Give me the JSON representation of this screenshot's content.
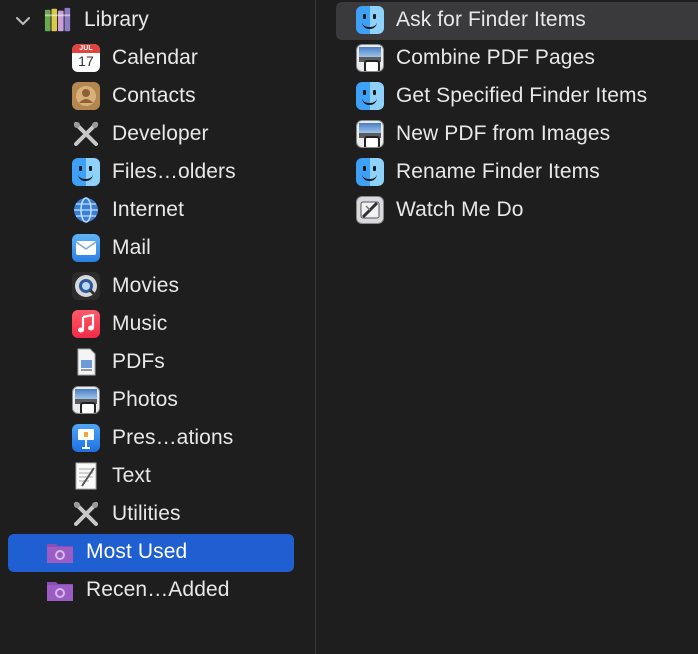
{
  "library": {
    "title": "Library",
    "categories": [
      {
        "label": "Calendar",
        "icon": "calendar-icon",
        "calendar_month": "JUL",
        "calendar_day": "17"
      },
      {
        "label": "Contacts",
        "icon": "contacts-icon"
      },
      {
        "label": "Developer",
        "icon": "developer-tools-icon"
      },
      {
        "label": "Files…olders",
        "icon": "finder-icon"
      },
      {
        "label": "Internet",
        "icon": "globe-icon"
      },
      {
        "label": "Mail",
        "icon": "mail-icon"
      },
      {
        "label": "Movies",
        "icon": "quicktime-icon"
      },
      {
        "label": "Music",
        "icon": "music-icon"
      },
      {
        "label": "PDFs",
        "icon": "pdf-document-icon"
      },
      {
        "label": "Photos",
        "icon": "preview-icon"
      },
      {
        "label": "Pres…ations",
        "icon": "keynote-icon"
      },
      {
        "label": "Text",
        "icon": "text-document-icon"
      },
      {
        "label": "Utilities",
        "icon": "utilities-tools-icon"
      }
    ],
    "smart_groups": [
      {
        "label": "Most Used",
        "icon": "smart-folder-icon",
        "selected": true
      },
      {
        "label": "Recen…Added",
        "icon": "smart-folder-icon",
        "selected": false
      }
    ]
  },
  "actions": [
    {
      "label": "Ask for Finder Items",
      "icon": "finder-icon",
      "selected": true
    },
    {
      "label": "Combine PDF Pages",
      "icon": "preview-icon",
      "selected": false
    },
    {
      "label": "Get Specified Finder Items",
      "icon": "finder-icon",
      "selected": false
    },
    {
      "label": "New PDF from Images",
      "icon": "preview-icon",
      "selected": false
    },
    {
      "label": "Rename Finder Items",
      "icon": "finder-icon",
      "selected": false
    },
    {
      "label": "Watch Me Do",
      "icon": "watch-me-do-icon",
      "selected": false
    }
  ],
  "colors": {
    "background": "#1e1e1e",
    "selection_active": "#1f5fd1",
    "selection_inactive": "#3a3a3c",
    "text": "#e8e8e8"
  }
}
